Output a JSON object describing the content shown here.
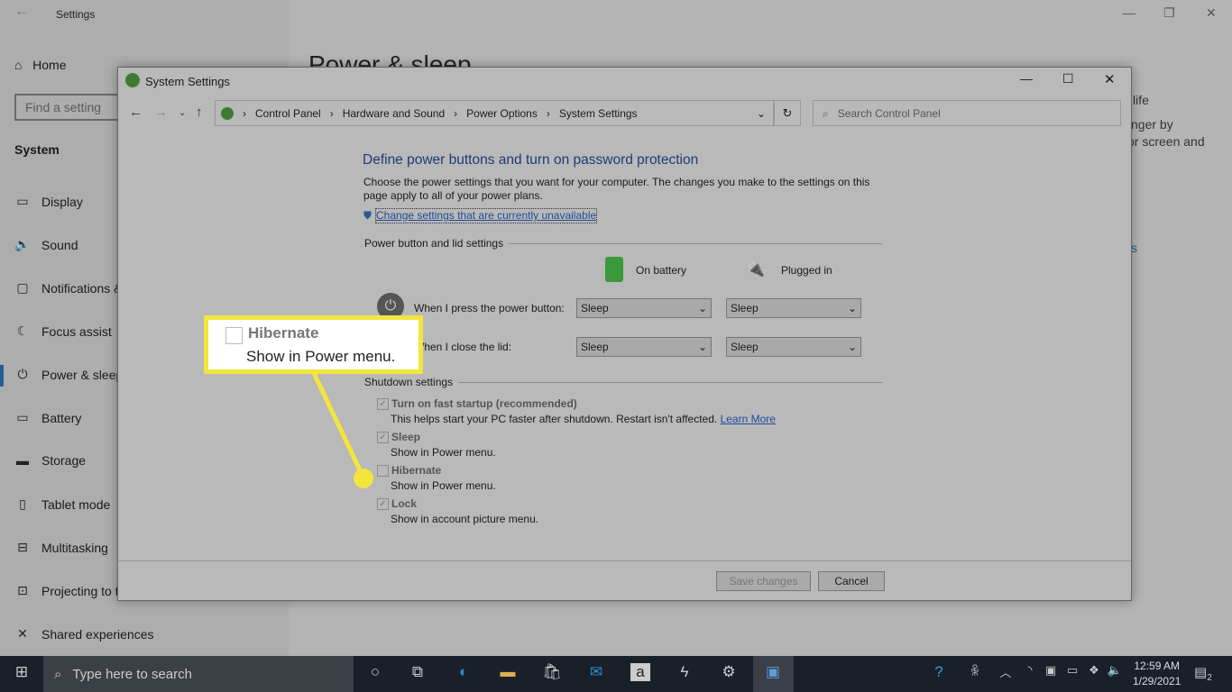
{
  "settings": {
    "title": "Settings",
    "home": "Home",
    "search_placeholder": "Find a setting",
    "section": "System",
    "nav": [
      {
        "label": "Display",
        "icon": "monitor-icon"
      },
      {
        "label": "Sound",
        "icon": "speaker-icon"
      },
      {
        "label": "Notifications & actions",
        "icon": "notifications-icon"
      },
      {
        "label": "Focus assist",
        "icon": "moon-icon"
      },
      {
        "label": "Power & sleep",
        "icon": "power-icon",
        "selected": true
      },
      {
        "label": "Battery",
        "icon": "battery-icon"
      },
      {
        "label": "Storage",
        "icon": "storage-icon"
      },
      {
        "label": "Tablet mode",
        "icon": "tablet-icon"
      },
      {
        "label": "Multitasking",
        "icon": "multitasking-icon"
      },
      {
        "label": "Projecting to this PC",
        "icon": "projecting-icon"
      },
      {
        "label": "Shared experiences",
        "icon": "shared-icon"
      }
    ],
    "page_title": "Power & sleep",
    "fragments": [
      "life",
      "nger by",
      "or screen and",
      "s"
    ]
  },
  "dialog": {
    "title": "System Settings",
    "breadcrumb": [
      "Control Panel",
      "Hardware and Sound",
      "Power Options",
      "System Settings"
    ],
    "search_placeholder": "Search Control Panel",
    "heading": "Define power buttons and turn on password protection",
    "description": "Choose the power settings that you want for your computer. The changes you make to the settings on this page apply to all of your power plans.",
    "change_link": "Change settings that are currently unavailable",
    "power_section": "Power button and lid settings",
    "col_battery": "On battery",
    "col_plugged": "Plugged in",
    "rows": [
      {
        "label": "When I press the power button:",
        "battery": "Sleep",
        "plugged": "Sleep"
      },
      {
        "label": "When I close the lid:",
        "battery": "Sleep",
        "plugged": "Sleep"
      }
    ],
    "shutdown_section": "Shutdown settings",
    "options": [
      {
        "label": "Turn on fast startup (recommended)",
        "desc": "This helps start your PC faster after shutdown. Restart isn't affected.",
        "link": "Learn More",
        "checked": true
      },
      {
        "label": "Sleep",
        "desc": "Show in Power menu.",
        "checked": true
      },
      {
        "label": "Hibernate",
        "desc": "Show in Power menu.",
        "checked": false
      },
      {
        "label": "Lock",
        "desc": "Show in account picture menu.",
        "checked": true
      }
    ],
    "save": "Save changes",
    "cancel": "Cancel"
  },
  "callout": {
    "label": "Hibernate",
    "desc": "Show in Power menu.",
    "color": "#f4e53c"
  },
  "taskbar": {
    "search_placeholder": "Type here to search",
    "time": "12:59 AM",
    "date": "1/29/2021",
    "notifications": "2"
  }
}
